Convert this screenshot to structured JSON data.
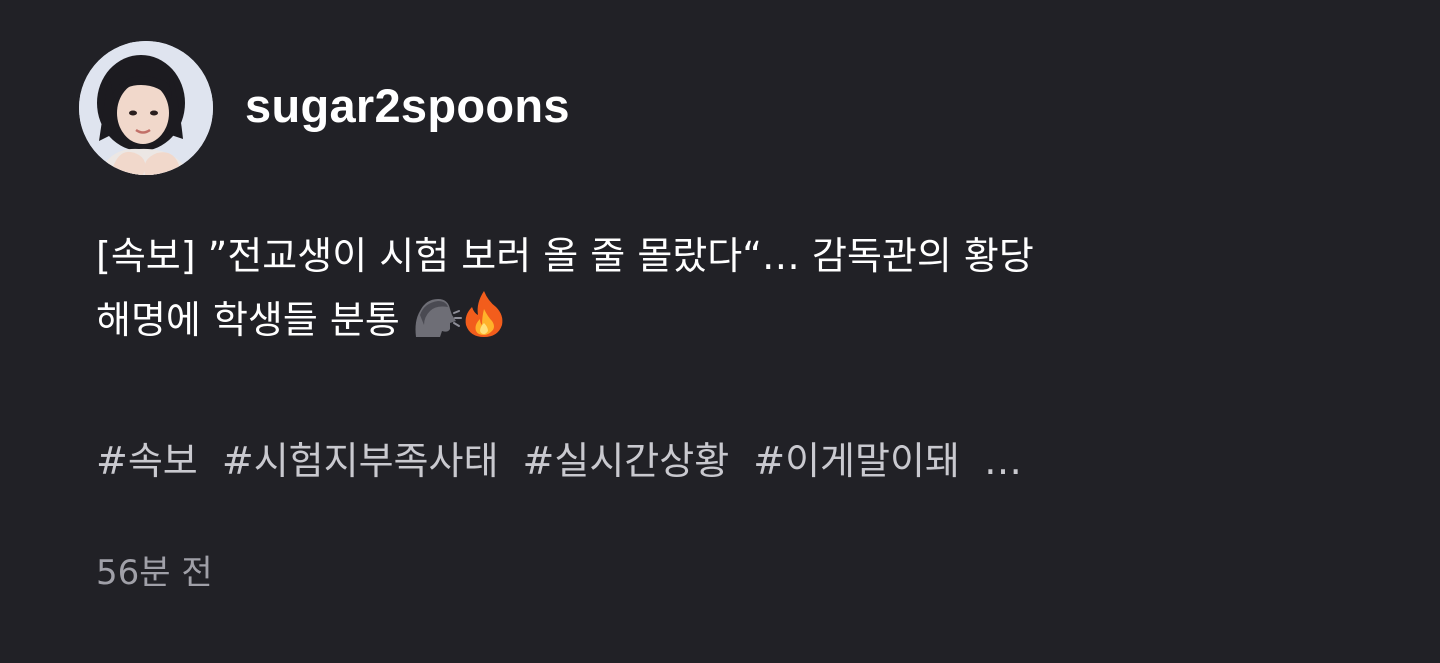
{
  "post": {
    "author": {
      "username": "sugar2spoons",
      "avatar_icon": "profile-photo"
    },
    "text": {
      "line1": "[속보] ”전교생이 시험 보러 올 줄 몰랐다“… 감독관의 황당",
      "line2": "해명에 학생들 분통",
      "emojis": [
        "speaking-head-icon",
        "fire-icon"
      ]
    },
    "hashtags": [
      "#속보",
      "#시험지부족사태",
      "#실시간상황",
      "#이게말이돼"
    ],
    "hashtags_more": "…",
    "timestamp": "56분 전"
  },
  "colors": {
    "background": "#212126",
    "text": "#ffffff",
    "hashtag": "#c9c9cf",
    "muted": "#a0a0a8"
  }
}
